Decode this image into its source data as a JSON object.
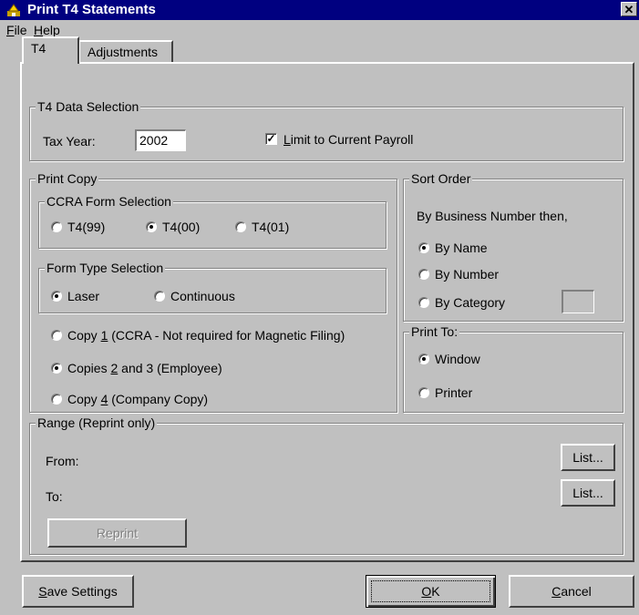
{
  "window": {
    "title": "Print T4 Statements",
    "close_glyph": "✕"
  },
  "menu": {
    "file": {
      "mnemonic": "F",
      "rest": "ile"
    },
    "help": {
      "mnemonic": "H",
      "rest": "elp"
    }
  },
  "tabs": [
    {
      "label": "T4",
      "active": true
    },
    {
      "label": "Adjustments",
      "active": false
    }
  ],
  "data_selection": {
    "legend": "T4 Data Selection",
    "tax_year_label": "Tax Year:",
    "tax_year_value": "2002",
    "limit_checkbox": {
      "checked": true,
      "mnemonic": "L",
      "rest": "imit to Current Payroll"
    }
  },
  "print_copy": {
    "legend": "Print Copy",
    "ccra": {
      "legend": "CCRA Form Selection",
      "options": [
        {
          "label": "T4(99)",
          "selected": false
        },
        {
          "label": "T4(00)",
          "selected": true
        },
        {
          "label": "T4(01)",
          "selected": false
        }
      ]
    },
    "form_type": {
      "legend": "Form Type Selection",
      "options": [
        {
          "label": "Laser",
          "selected": true
        },
        {
          "label": "Continuous",
          "selected": false
        }
      ]
    },
    "copies": [
      {
        "before": "Copy ",
        "mnemonic": "1",
        "after": " (CCRA - Not required for Magnetic Filing)",
        "selected": false
      },
      {
        "before": "Copies ",
        "mnemonic": "2",
        "after": " and 3 (Employee)",
        "selected": true
      },
      {
        "before": "Copy ",
        "mnemonic": "4",
        "after": " (Company Copy)",
        "selected": false
      }
    ]
  },
  "sort_order": {
    "legend": "Sort Order",
    "caption": "By Business Number then,",
    "options": [
      {
        "label": "By Name",
        "selected": true
      },
      {
        "label": "By Number",
        "selected": false
      },
      {
        "label": "By Category",
        "selected": false
      }
    ]
  },
  "print_to": {
    "legend": "Print To:",
    "options": [
      {
        "label": "Window",
        "selected": true
      },
      {
        "label": "Printer",
        "selected": false
      }
    ]
  },
  "range": {
    "legend": "Range (Reprint only)",
    "from_label": "From:",
    "to_label": "To:",
    "list_button": "List...",
    "reprint_button": "Reprint"
  },
  "footer": {
    "save_settings": {
      "mnemonic": "S",
      "rest": "ave Settings"
    },
    "ok": {
      "mnemonic": "O",
      "rest": "K"
    },
    "cancel": {
      "mnemonic": "C",
      "rest": "ancel"
    }
  }
}
